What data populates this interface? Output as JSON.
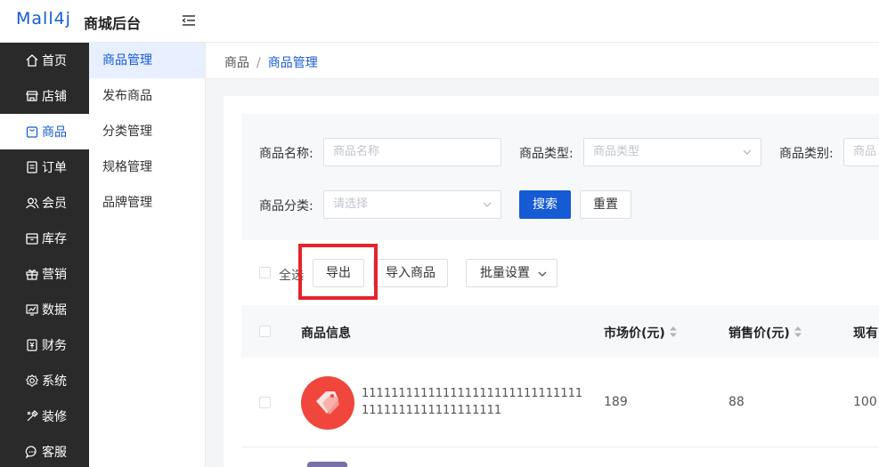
{
  "header": {
    "logo": "Mall4j",
    "title": "商城后台"
  },
  "sidebar": {
    "items": [
      {
        "label": "首页",
        "icon": "home-icon"
      },
      {
        "label": "店铺",
        "icon": "shop-icon"
      },
      {
        "label": "商品",
        "icon": "bag-icon",
        "active": true
      },
      {
        "label": "订单",
        "icon": "order-icon"
      },
      {
        "label": "会员",
        "icon": "member-icon"
      },
      {
        "label": "库存",
        "icon": "stock-icon"
      },
      {
        "label": "营销",
        "icon": "gift-icon"
      },
      {
        "label": "数据",
        "icon": "chart-icon"
      },
      {
        "label": "财务",
        "icon": "finance-icon"
      },
      {
        "label": "系统",
        "icon": "gear-icon"
      },
      {
        "label": "装修",
        "icon": "decor-icon"
      },
      {
        "label": "客服",
        "icon": "chat-icon"
      }
    ]
  },
  "subsidebar": {
    "items": [
      {
        "label": "商品管理",
        "active": true
      },
      {
        "label": "发布商品"
      },
      {
        "label": "分类管理"
      },
      {
        "label": "规格管理"
      },
      {
        "label": "品牌管理"
      }
    ]
  },
  "breadcrumb": {
    "root": "商品",
    "separator": "/",
    "current": "商品管理"
  },
  "search": {
    "name_label": "商品名称:",
    "name_placeholder": "商品名称",
    "type_label": "商品类型:",
    "type_placeholder": "商品类型",
    "category_label": "商品类别:",
    "category_placeholder": "商品",
    "group_label": "商品分类:",
    "group_placeholder": "请选择",
    "search_button": "搜索",
    "reset_button": "重置"
  },
  "toolbar": {
    "select_all": "全选",
    "export_button": "导出",
    "import_button": "导入商品",
    "batch_button": "批量设置"
  },
  "table": {
    "columns": [
      "商品信息",
      "市场价(元)",
      "销售价(元)",
      "现有"
    ],
    "rows": [
      {
        "name": "1111111111111111111111111111111111111111111111111",
        "market_price": "189",
        "sale_price": "88",
        "stock": "100"
      }
    ]
  },
  "colors": {
    "accent": "#155bd4",
    "sidebar_bg": "#2a2a2a",
    "highlight": "#e5222c"
  }
}
